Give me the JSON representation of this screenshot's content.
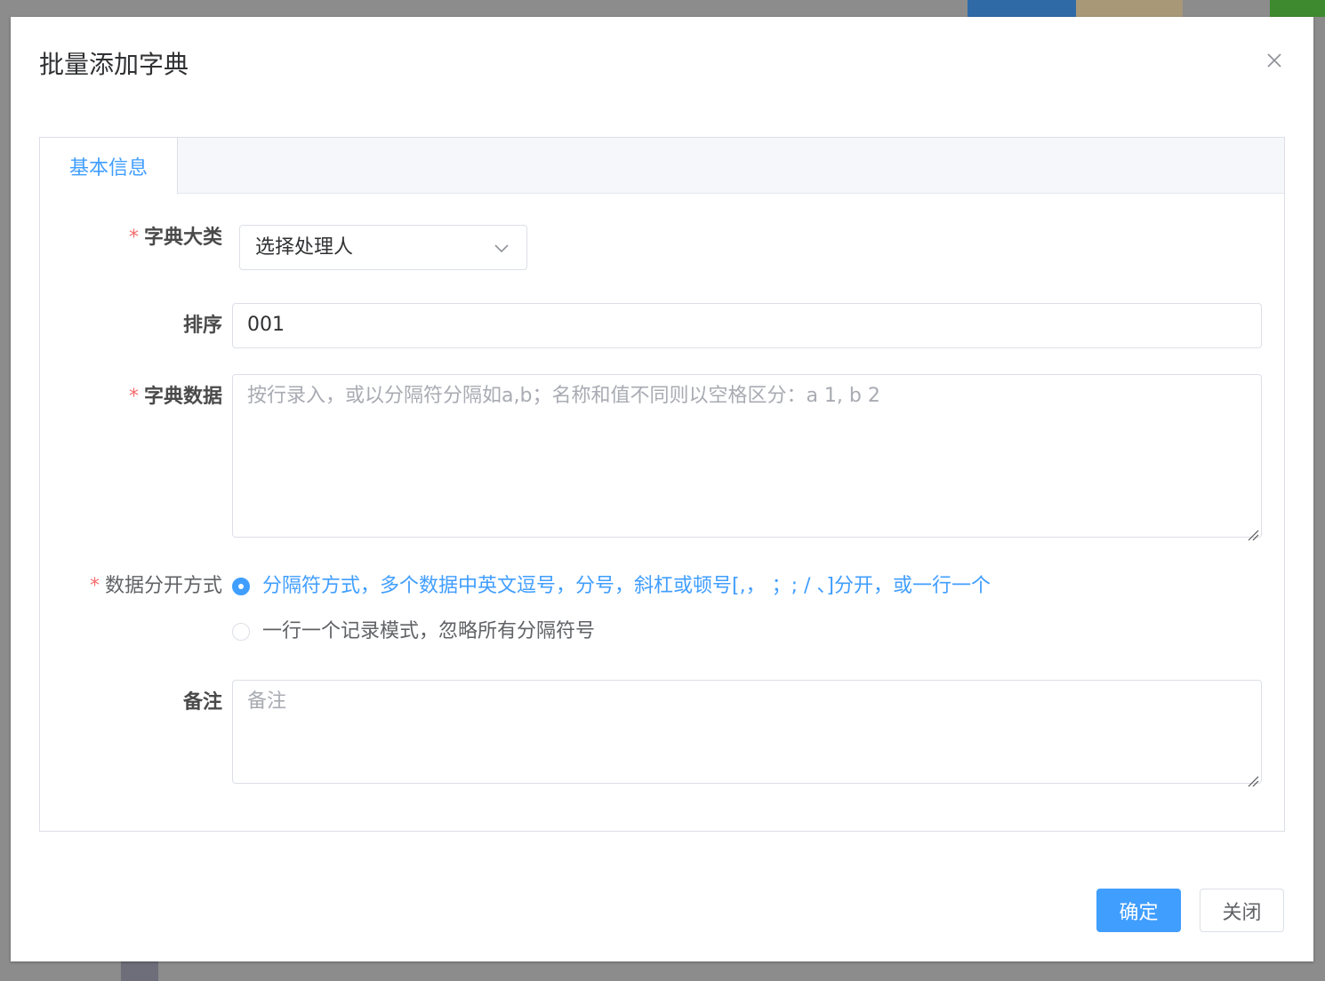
{
  "dialog": {
    "title": "批量添加字典",
    "close_icon": "close-icon"
  },
  "tabs": [
    {
      "label": "基本信息",
      "active": true
    }
  ],
  "form": {
    "category": {
      "label": "字典大类",
      "required": true,
      "value": "选择处理人",
      "icon": "chevron-down-icon"
    },
    "sort": {
      "label": "排序",
      "value": "001"
    },
    "dict_data": {
      "label": "字典数据",
      "required": true,
      "value": "",
      "placeholder": "按行录入，或以分隔符分隔如a,b；名称和值不同则以空格区分：a 1, b 2"
    },
    "split_mode": {
      "label": "数据分开方式",
      "required": true,
      "options": [
        {
          "label": "分隔符方式，多个数据中英文逗号，分号，斜杠或顿号[,， ；;  / 、]分开，或一行一个",
          "checked": true
        },
        {
          "label": "一行一个记录模式，忽略所有分隔符号",
          "checked": false
        }
      ]
    },
    "remark": {
      "label": "备注",
      "value": "",
      "placeholder": "备注"
    }
  },
  "footer": {
    "confirm_label": "确定",
    "close_label": "关闭"
  },
  "colors": {
    "primary": "#409eff",
    "required": "#f56c6c",
    "border": "#dcdfe6",
    "placeholder": "#a8abb2"
  }
}
